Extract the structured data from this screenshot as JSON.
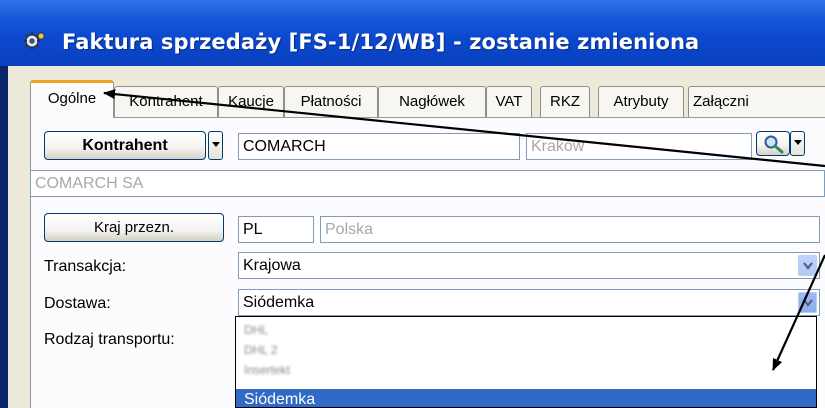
{
  "window": {
    "title": "Faktura sprzedaży [FS-1/12/WB]  - zostanie zmieniona"
  },
  "tabs": [
    {
      "label": "Ogólne",
      "active": true
    },
    {
      "label": "Kontrahent"
    },
    {
      "label": "Kaucje"
    },
    {
      "label": "Płatności"
    },
    {
      "label": "Nagłówek"
    },
    {
      "label": "VAT"
    },
    {
      "label": "RKZ"
    },
    {
      "label": "Atrybuty"
    },
    {
      "label": "Załączni"
    }
  ],
  "form": {
    "kontrahent_button": "Kontrahent",
    "kontrahent_code": "COMARCH",
    "kontrahent_city": "Kraków",
    "kontrahent_name": "COMARCH SA",
    "kraj_button": "Kraj przezn.",
    "kraj_code": "PL",
    "kraj_name": "Polska",
    "transakcja_label": "Transakcja:",
    "transakcja_value": "Krajowa",
    "dostawa_label": "Dostawa:",
    "dostawa_value": "Siódemka",
    "rodzaj_label": "Rodzaj transportu:"
  },
  "dropdown": {
    "items": [
      "DHL",
      "DHL 2",
      "Insertekt"
    ],
    "selected": "Siódemka"
  },
  "icons": {
    "title": "app-gear-icon",
    "search": "magnifier-icon",
    "combo": "chevron-down-icon"
  },
  "colors": {
    "title_bar": "#0b49cf",
    "selection": "#316ac5",
    "active_tab_accent": "#f0a022",
    "annotation_arrow": "#000000"
  }
}
